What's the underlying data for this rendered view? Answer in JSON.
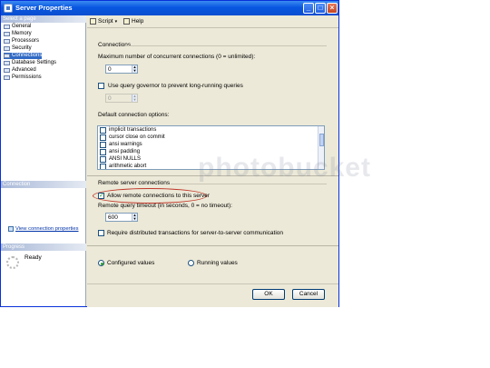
{
  "window": {
    "title": "Server Properties"
  },
  "titlebar_buttons": {
    "minimize": "_",
    "maximize": "□",
    "close": "×"
  },
  "left_pane": {
    "select_page_header": "Select a page",
    "pages": [
      "General",
      "Memory",
      "Processors",
      "Security",
      "Connections",
      "Database Settings",
      "Advanced",
      "Permissions"
    ],
    "selected_page": "Connections",
    "connection_header": "Connection",
    "view_connection_properties": "View connection properties",
    "progress_header": "Progress",
    "progress_status": "Ready"
  },
  "toolbar": {
    "script_label": "Script",
    "help_label": "Help",
    "script_caret": "▾"
  },
  "connections": {
    "group_title": "Connections",
    "max_connections_label": "Maximum number of concurrent connections (0 = unlimited):",
    "max_connections_value": "0",
    "query_governor_label": "Use query governor to prevent long-running queries",
    "query_governor_checked": false,
    "query_governor_value": "0",
    "default_options_label": "Default connection options:",
    "default_options": [
      {
        "label": "implicit transactions",
        "checked": false
      },
      {
        "label": "cursor close on commit",
        "checked": false
      },
      {
        "label": "ansi warnings",
        "checked": false
      },
      {
        "label": "ansi padding",
        "checked": false
      },
      {
        "label": "ANSI NULLS",
        "checked": false
      },
      {
        "label": "arithmetic abort",
        "checked": false
      }
    ]
  },
  "remote": {
    "group_title": "Remote server connections",
    "allow_remote_label": "Allow remote connections to this server",
    "allow_remote_checked": true,
    "timeout_label": "Remote query timeout (in seconds, 0 = no timeout):",
    "timeout_value": "600",
    "distributed_tx_label": "Require distributed transactions for server-to-server communication",
    "distributed_tx_checked": false
  },
  "values_mode": {
    "configured_label": "Configured values",
    "running_label": "Running values",
    "selected": "configured"
  },
  "footer": {
    "ok_label": "OK",
    "cancel_label": "Cancel"
  },
  "watermark_text": "photobucket",
  "colors": {
    "titlebar": "#0856e0",
    "selected_item": "#316ac5",
    "highlight_ellipse": "#c0392b"
  }
}
